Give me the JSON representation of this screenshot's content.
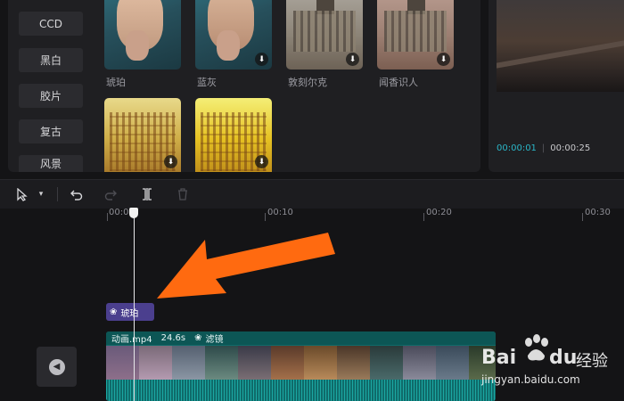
{
  "categories": [
    "CCD",
    "黑白",
    "胶片",
    "复古",
    "风景"
  ],
  "filters_row1": [
    {
      "label": "琥珀",
      "downloadable": false
    },
    {
      "label": "蓝灰",
      "downloadable": true
    },
    {
      "label": "敦刻尔克",
      "downloadable": true
    },
    {
      "label": "闻香识人",
      "downloadable": true
    }
  ],
  "filters_row2": [
    {
      "label": "",
      "downloadable": true
    },
    {
      "label": "",
      "downloadable": true
    }
  ],
  "preview": {
    "current_time": "00:00:01",
    "total_time": "00:00:25",
    "current_color": "#2ab6c8"
  },
  "ruler": {
    "labels": [
      "00:00",
      "00:10",
      "00:20",
      "00:30"
    ]
  },
  "filter_clip": {
    "label": "琥珀",
    "color": "#4b3f8e"
  },
  "video_clip": {
    "filename": "动画.mp4",
    "duration": "24.6s",
    "filter_tag": "滤镜",
    "color": "#0f6b6a"
  },
  "watermark": {
    "brand": "Bai",
    "brand2": "du",
    "site": "经验",
    "url": "jingyan.baidu.com"
  },
  "accent_arrow": "#ff6a10"
}
